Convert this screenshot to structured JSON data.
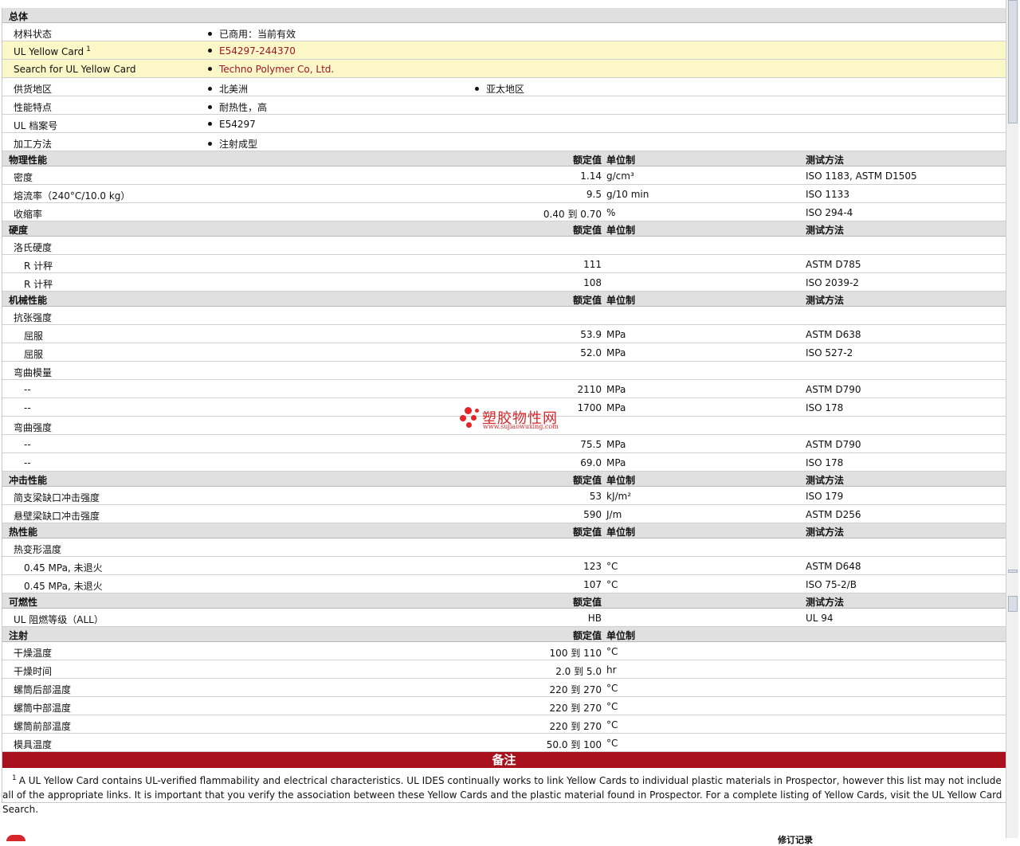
{
  "general": {
    "header": "总体",
    "rows": [
      {
        "label": "材料状态",
        "items": [
          "已商用：当前有效"
        ]
      },
      {
        "label": "UL Yellow Card",
        "sup": "1",
        "items": [
          "E54297-244370"
        ],
        "highlight": true,
        "link": true
      },
      {
        "label": "Search for UL Yellow Card",
        "items": [
          "Techno Polymer Co, Ltd."
        ],
        "highlight": true,
        "link": true
      },
      {
        "label": "供货地区",
        "items": [
          "北美洲",
          "亚太地区"
        ]
      },
      {
        "label": "性能特点",
        "items": [
          "耐热性，高"
        ]
      },
      {
        "label": "UL 档案号",
        "items": [
          "E54297"
        ]
      },
      {
        "label": "加工方法",
        "items": [
          "注射成型"
        ]
      }
    ]
  },
  "sections": [
    {
      "title": "物理性能",
      "col_value": "额定值",
      "col_unit": "单位制",
      "col_test": "测试方法",
      "rows": [
        {
          "label": "密度",
          "value": "1.14",
          "unit": "g/cm³",
          "test": "ISO 1183, ASTM D1505"
        },
        {
          "label": "熔流率（240°C/10.0 kg）",
          "value": "9.5",
          "unit": "g/10 min",
          "test": "ISO 1133"
        },
        {
          "label": "收缩率",
          "value": "0.40 到  0.70",
          "unit": "%",
          "test": "ISO 294-4"
        }
      ]
    },
    {
      "title": "硬度",
      "col_value": "额定值",
      "col_unit": "单位制",
      "col_test": "测试方法",
      "rows": [
        {
          "label": "洛氏硬度"
        },
        {
          "label": "R 计秤",
          "sub": true,
          "value": "111",
          "test": "ASTM D785"
        },
        {
          "label": "R 计秤",
          "sub": true,
          "value": "108",
          "test": "ISO 2039-2"
        }
      ]
    },
    {
      "title": "机械性能",
      "col_value": "额定值",
      "col_unit": "单位制",
      "col_test": "测试方法",
      "rows": [
        {
          "label": "抗张强度"
        },
        {
          "label": "屈服",
          "sub": true,
          "value": "53.9",
          "unit": "MPa",
          "test": "ASTM D638"
        },
        {
          "label": "屈服",
          "sub": true,
          "value": "52.0",
          "unit": "MPa",
          "test": "ISO 527-2"
        },
        {
          "label": "弯曲模量"
        },
        {
          "label": "--",
          "sub": true,
          "value": "2110",
          "unit": "MPa",
          "test": "ASTM D790"
        },
        {
          "label": "--",
          "sub": true,
          "value": "1700",
          "unit": "MPa",
          "test": "ISO 178"
        },
        {
          "label": "弯曲强度"
        },
        {
          "label": "--",
          "sub": true,
          "value": "75.5",
          "unit": "MPa",
          "test": "ASTM D790"
        },
        {
          "label": "--",
          "sub": true,
          "value": "69.0",
          "unit": "MPa",
          "test": "ISO 178"
        }
      ]
    },
    {
      "title": "冲击性能",
      "col_value": "额定值",
      "col_unit": "单位制",
      "col_test": "测试方法",
      "rows": [
        {
          "label": "简支梁缺口冲击强度",
          "value": "53",
          "unit": "kJ/m²",
          "test": "ISO 179"
        },
        {
          "label": "悬壁梁缺口冲击强度",
          "value": "590",
          "unit": "J/m",
          "test": "ASTM D256"
        }
      ]
    },
    {
      "title": "热性能",
      "col_value": "额定值",
      "col_unit": "单位制",
      "col_test": "测试方法",
      "rows": [
        {
          "label": "热变形温度"
        },
        {
          "label": "0.45 MPa, 未退火",
          "sub": true,
          "value": "123",
          "unit": "°C",
          "test": "ASTM D648"
        },
        {
          "label": "0.45 MPa, 未退火",
          "sub": true,
          "value": "107",
          "unit": "°C",
          "test": "ISO 75-2/B"
        }
      ]
    },
    {
      "title": "可燃性",
      "col_value": "额定值",
      "col_unit": "",
      "col_test": "测试方法",
      "rows": [
        {
          "label": "UL 阻燃等级（ALL）",
          "value": "HB",
          "test": "UL 94"
        }
      ]
    },
    {
      "title": "注射",
      "col_value": "额定值",
      "col_unit": "单位制",
      "col_test": "",
      "rows": [
        {
          "label": "干燥温度",
          "value": "100 到  110",
          "unit": "°C"
        },
        {
          "label": "干燥时间",
          "value": "2.0 到  5.0",
          "unit": "hr"
        },
        {
          "label": "螺筒后部温度",
          "value": "220 到  270",
          "unit": "°C"
        },
        {
          "label": "螺筒中部温度",
          "value": "220 到  270",
          "unit": "°C"
        },
        {
          "label": "螺筒前部温度",
          "value": "220 到  270",
          "unit": "°C"
        },
        {
          "label": "模具温度",
          "value": "50.0 到  100",
          "unit": "°C"
        }
      ]
    }
  ],
  "notes": {
    "title": "备注",
    "marker": "1",
    "text": "A UL Yellow Card contains UL-verified flammability and electrical characteristics. UL IDES continually works to link Yellow Cards to individual plastic materials in Prospector, however this list may not include all of the appropriate links. It is important that you verify the association between these Yellow Cards and the plastic material found in Prospector. For a complete listing of Yellow Cards, visit the UL Yellow Card Search."
  },
  "watermark": {
    "name": "塑胶物性网",
    "url": "www.sujiaowuxing.com"
  },
  "footer": {
    "history": "修订记录"
  },
  "colors": {
    "notes_bar": "#a8101e",
    "highlight_row": "#fbf7c6",
    "link": "#a0152a",
    "header_row": "#e0e0e0"
  }
}
